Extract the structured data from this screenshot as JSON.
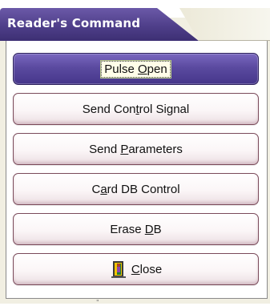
{
  "window": {
    "title": "Reader's Command"
  },
  "buttons": [
    {
      "id": "pulse-open",
      "pre": "Pulse ",
      "mn": "O",
      "post": "pen"
    },
    {
      "id": "send-control-signal",
      "pre": "Send Con",
      "mn": "t",
      "post": "rol Signal"
    },
    {
      "id": "send-parameters",
      "pre": "Send ",
      "mn": "P",
      "post": "arameters"
    },
    {
      "id": "card-db-control",
      "pre": "C",
      "mn": "a",
      "post": "rd DB Control"
    },
    {
      "id": "erase-db",
      "pre": "Erase ",
      "mn": "D",
      "post": "B"
    },
    {
      "id": "close",
      "pre": "",
      "mn": "C",
      "post": "lose",
      "icon": "exit-door-icon"
    }
  ],
  "colors": {
    "title_bar": "#4f3f8a",
    "primary_button": "#5b4aa0",
    "button_border": "#7a4a5a"
  },
  "footer": {
    "marker": "\""
  }
}
